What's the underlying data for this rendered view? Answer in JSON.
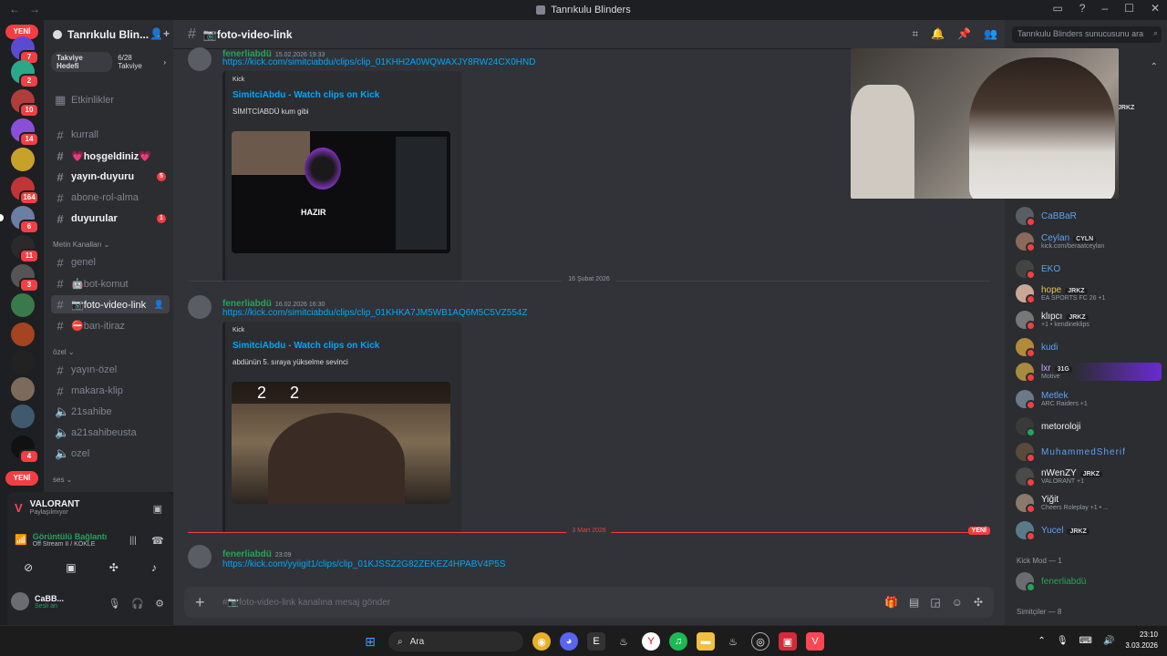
{
  "window": {
    "title": "Tanrıkulu Blinders",
    "nav_back": "←",
    "nav_fwd": "→"
  },
  "server_rail": {
    "yeni_top": "YENİ",
    "yeni_bottom": "YENİ",
    "badges": [
      "7",
      "2",
      "10",
      "14",
      "164",
      "6",
      "11",
      "3",
      "4"
    ]
  },
  "guild": {
    "name": "Tanrıkulu Blin...",
    "boost_goal": "Takviye Hedefi",
    "boost_count": "6/28 Takviye",
    "events": "Etkinlikler"
  },
  "channels": [
    {
      "name": "kurrall",
      "unread": false
    },
    {
      "name": "💗hoşgeldiniz💗",
      "unread": true
    },
    {
      "name": "yayın-duyuru",
      "unread": true,
      "count": "5"
    },
    {
      "name": "abone-rol-alma",
      "unread": false
    },
    {
      "name": "duyurular",
      "unread": true,
      "count": "1"
    }
  ],
  "categories": {
    "metin": "Metin Kanalları",
    "ozel": "özel",
    "ses": "ses"
  },
  "metin_channels": [
    "genel",
    "🤖bot-komut",
    "📷foto-video-link",
    "⛔ban-itiraz"
  ],
  "ozel_channels": [
    "yayın-özel",
    "makara-klip",
    "21sahibe",
    "a21sahibeusta",
    "ozel"
  ],
  "voice": {
    "game": "VALORANT",
    "game_status": "Paylaşılmıyor",
    "connection": "Görüntülü Bağlantı",
    "channel_path": "Off Stream II / KÖKLE",
    "user": "CaBB...",
    "user_status": "Sesli an"
  },
  "header": {
    "channel": "📷foto-video-link",
    "search_placeholder": "Tanrıkulu Blinders sunucusunu ara"
  },
  "messages": [
    {
      "author": "fenerliabdü",
      "timestamp": "15.02.2026 19:33",
      "link": "https://kick.com/simitciabdu/clips/clip_01KHH2A0WQWAXJY8RW24CX0HND",
      "embed_provider": "Kick",
      "embed_title": "SimitciAbdu - Watch clips on Kick",
      "embed_desc": "SİMİTCİABDÜ kum gibi",
      "thumb_text": "HAZIR"
    },
    {
      "author": "fenerliabdü",
      "timestamp": "16.02.2026 16:30",
      "link": "https://kick.com/simitciabdu/clips/clip_01KHKA7JM5WB1AQ6M5C5VZ554Z",
      "embed_provider": "Kick",
      "embed_title": "SimitciAbdu - Watch clips on Kick",
      "embed_desc": "abdünün 5. sıraya yükselme sevinci",
      "thumb_score_a": "2",
      "thumb_score_b": "2"
    },
    {
      "author": "fenerliabdü",
      "timestamp": "23:09",
      "link": "https://kick.com/yyiigit1/clips/clip_01KJSSZ2G82ZEKEZ4HPABV4P5S"
    }
  ],
  "dividers": {
    "d1": "16 Şubat 2026",
    "d2": "3 Mart 2026",
    "yeni": "YENİ"
  },
  "composer": {
    "placeholder": "#📷foto-video-link kanalına mesaj gönder"
  },
  "members": [
    {
      "name": "CaBBaR",
      "sub": ""
    },
    {
      "name": "Ceylan",
      "tag": "CYLN",
      "sub": "kick.com/beraatceylan"
    },
    {
      "name": "EKO",
      "sub": ""
    },
    {
      "name": "hope",
      "tag": "JRKZ",
      "sub": "EA SPORTS FC 26 +1"
    },
    {
      "name": "klıpcı",
      "tag": "JRKZ",
      "sub": "+1 • kendineklips"
    },
    {
      "name": "kudi",
      "sub": ""
    },
    {
      "name": "lxr",
      "tag": "31G",
      "sub": "Motive"
    },
    {
      "name": "Metlek",
      "sub": "ARC Raiders +1"
    },
    {
      "name": "metoroloji",
      "sub": ""
    },
    {
      "name": "MuhammedSherif",
      "sub": ""
    },
    {
      "name": "nWenZY",
      "tag": "JRKZ",
      "sub": "VALORANT +1"
    },
    {
      "name": "Yiğit",
      "sub": "Cheers Roleplay +1 • ..."
    },
    {
      "name": "Yucel",
      "tag": "JRKZ",
      "sub": ""
    }
  ],
  "member_groups": {
    "kick_mod": "Kick Mod — 1",
    "kick_mod_member": "fenerliabdü",
    "simitciler": "Simitçiler — 8",
    "top_tag": "JRKZ"
  },
  "taskbar": {
    "search": "Ara",
    "time": "23:10",
    "date": "3.03.2026"
  },
  "colors": {
    "accent": "#5865f2",
    "link": "#00a8fc",
    "online": "#23a55a",
    "danger": "#f23f43"
  }
}
